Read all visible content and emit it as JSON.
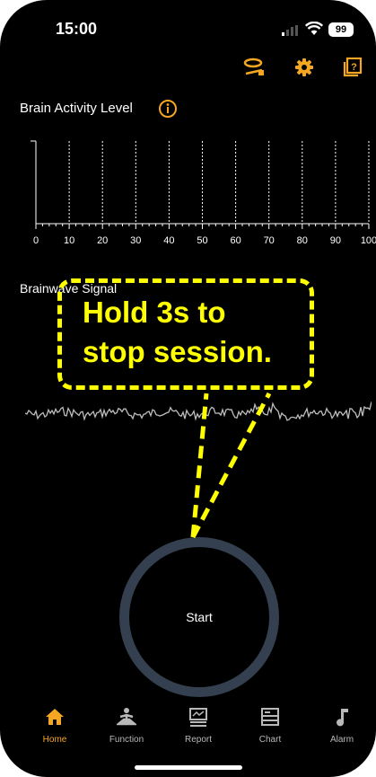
{
  "status_bar": {
    "time": "15:00",
    "battery": "99"
  },
  "activity": {
    "title": "Brain Activity Level",
    "x_ticks": [
      "0",
      "10",
      "20",
      "30",
      "40",
      "50",
      "60",
      "70",
      "80",
      "90",
      "100"
    ]
  },
  "wave": {
    "title": "Brainwave Signal"
  },
  "start": {
    "label": "Start"
  },
  "tabs": [
    {
      "label": "Home",
      "icon": "home-icon"
    },
    {
      "label": "Function",
      "icon": "meditation-icon"
    },
    {
      "label": "Report",
      "icon": "report-icon"
    },
    {
      "label": "Chart",
      "icon": "chart-icon"
    },
    {
      "label": "Alarm",
      "icon": "music-note-icon"
    }
  ],
  "callout": {
    "line1": "Hold 3s to",
    "line2": "stop session."
  },
  "colors": {
    "accent": "#f5a623",
    "callout": "#ffff00",
    "ring": "#34404f"
  }
}
